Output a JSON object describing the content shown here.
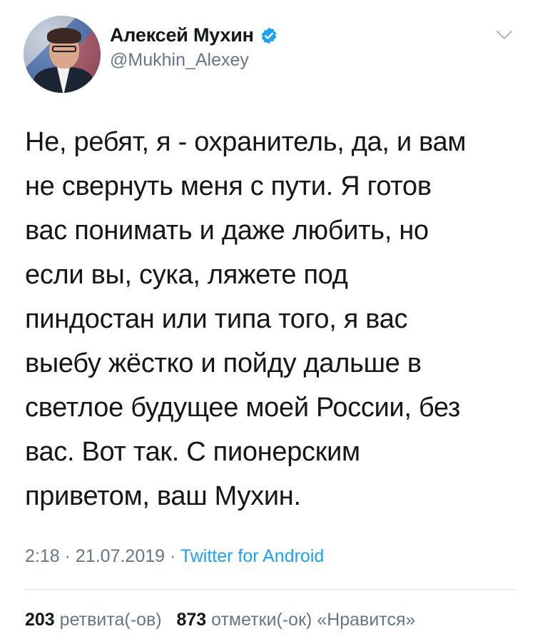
{
  "author": {
    "name": "Алексей Мухин",
    "handle": "@Mukhin_Alexey",
    "verified_icon": "verified-badge-icon",
    "avatar": "author-avatar"
  },
  "tweet": {
    "text": "Не, ребят, я - охранитель, да, и вам\nне свернуть меня с пути. Я готов\nвас понимать и даже любить, но\nесли вы, сука, ляжете под\nпиндостан или типа того, я вас\nвыебу жёстко и пойду дальше в\nсветлое будущее моей России, без\nвас. Вот так. С пионерским\nприветом, ваш Мухин.",
    "time": "2:18",
    "date": "21.07.2019",
    "separator": "·",
    "source": "Twitter for Android"
  },
  "stats": {
    "retweets_count": "203",
    "retweets_label": "ретвита(-ов)",
    "likes_count": "873",
    "likes_label": "отметки(-ок) «Нравится»"
  },
  "colors": {
    "accent": "#1da1f2",
    "muted": "#657786",
    "text": "#14171a",
    "divider": "#dfe3e8"
  }
}
